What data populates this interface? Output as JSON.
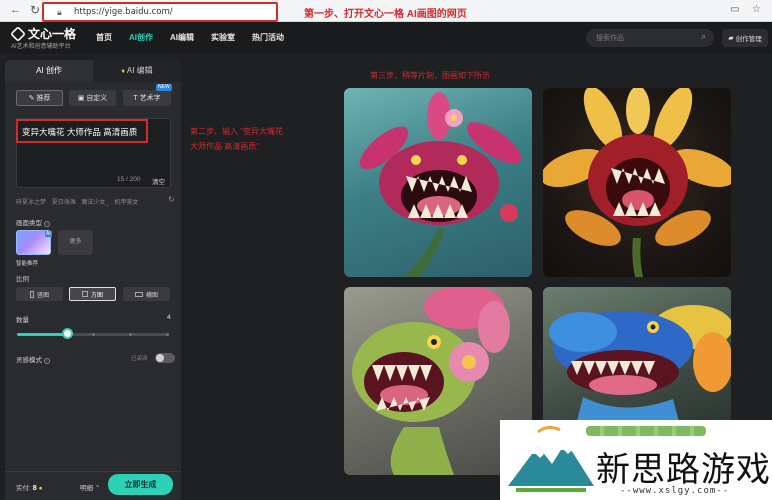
{
  "browser": {
    "url": "https://yige.baidu.com/",
    "step1": "第一步、打开文心一格 AI画图的网页"
  },
  "header": {
    "app_name": "文心一格",
    "app_subtitle": "AI艺术和创意辅助平台",
    "nav": [
      "首页",
      "AI创作",
      "AI编辑",
      "实验室",
      "热门活动"
    ],
    "active_nav": "AI创作",
    "search_placeholder": "搜索作品",
    "manage_label": "创作管理"
  },
  "panel": {
    "tabs": {
      "create": "AI 创作",
      "edit": "AI 编辑"
    },
    "modes": {
      "recommend": "推荐",
      "custom": "自定义",
      "art_font": "艺术字",
      "new_badge": "NEW"
    },
    "prompt": {
      "text": "变异大嘴花 大师作品 高清画质",
      "count": "15 / 200",
      "clear": "清空"
    },
    "suggestions": [
      "碎夏冰之梦",
      "夏日海滩",
      "魔法少女_",
      "机甲美女"
    ],
    "style_label": "画面类型",
    "style_ai_badge": "AI",
    "style_more": "更多",
    "style_caption": "智能推荐",
    "ratio_label": "比例",
    "ratios": {
      "vertical": "竖图",
      "square": "方图",
      "horizontal": "横图"
    },
    "quantity_label": "数量",
    "quantity_value": "4",
    "quantity_fraction": 0.33,
    "inspire_label": "灵感模式",
    "inspire_state": "已关闭",
    "credits_label": "实付:",
    "credits_value": "8",
    "detail_label": "明细",
    "generate_label": "立即生成"
  },
  "annotations": {
    "step2_line1": "第二步、输入 \"变异大嘴花",
    "step2_line2": "大师作品 高清画质\"",
    "step3": "第三步、稍等片刻，图画如下所示"
  },
  "watermark": {
    "title": "新思路游戏",
    "url": "--www.xslgy.com--"
  }
}
